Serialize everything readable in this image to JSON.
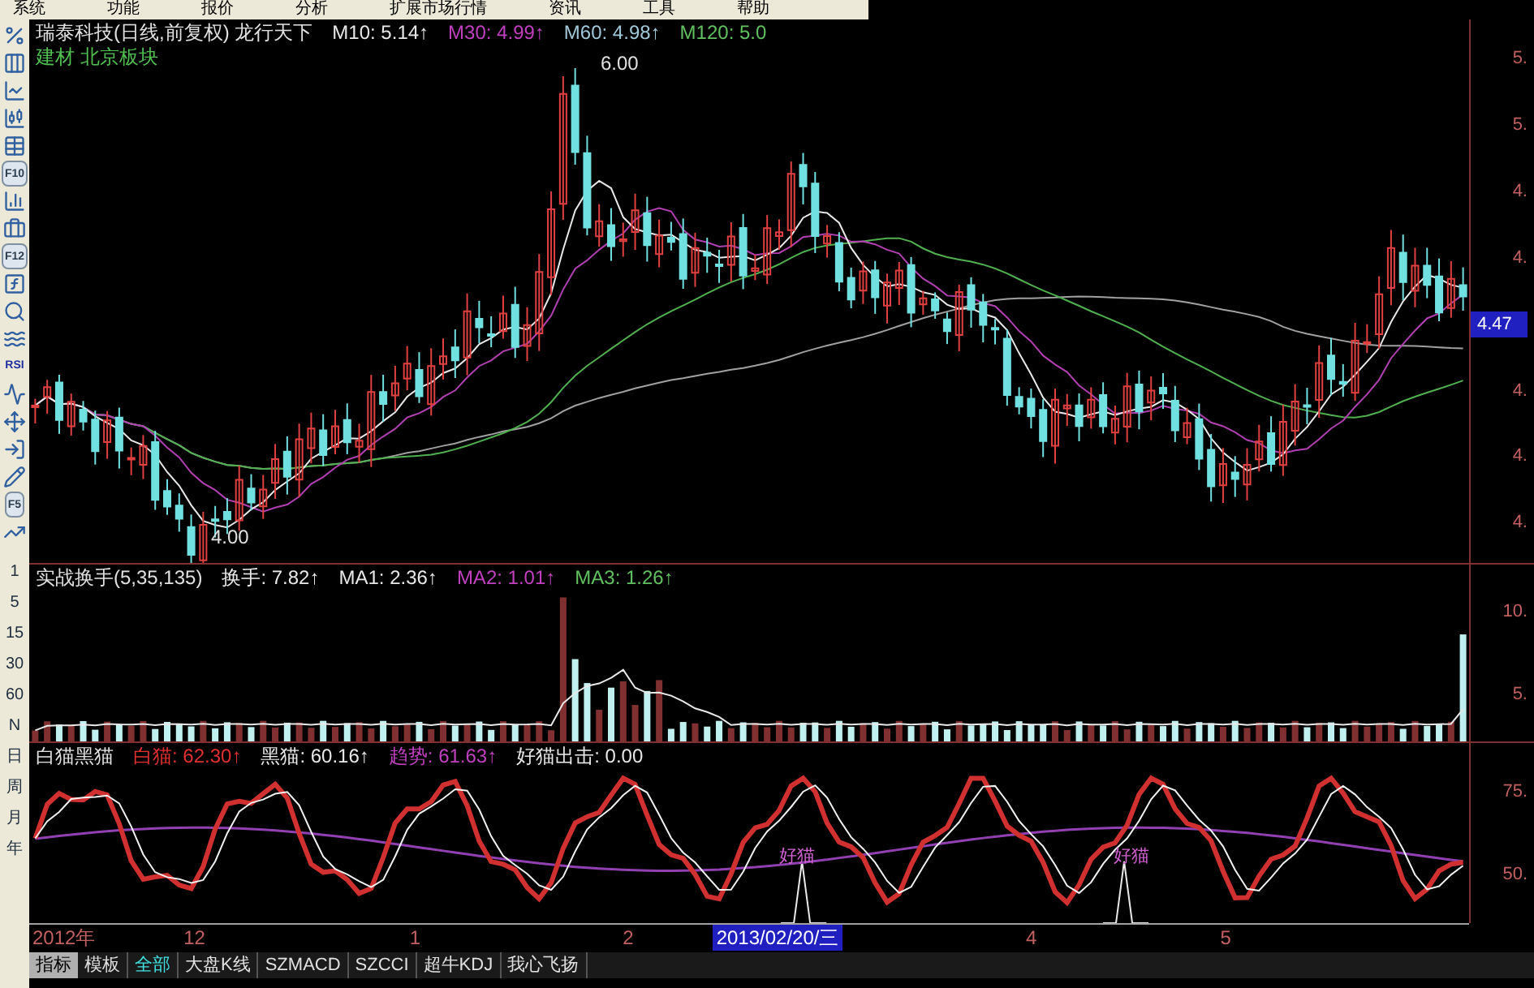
{
  "menu": [
    "系统",
    "功能",
    "报价",
    "分析",
    "扩展市场行情",
    "资讯",
    "工具",
    "帮助"
  ],
  "sidebar": {
    "items": [
      {
        "kind": "icon"
      },
      {
        "kind": "icon"
      },
      {
        "kind": "icon"
      },
      {
        "kind": "icon"
      },
      {
        "kind": "icon"
      },
      {
        "kind": "label",
        "text": "F10"
      },
      {
        "kind": "icon"
      },
      {
        "kind": "icon"
      },
      {
        "kind": "label",
        "text": "F12"
      },
      {
        "kind": "icon"
      },
      {
        "kind": "icon"
      },
      {
        "kind": "icon"
      },
      {
        "kind": "label",
        "text": "RSI"
      },
      {
        "kind": "icon"
      },
      {
        "kind": "icon"
      },
      {
        "kind": "icon"
      },
      {
        "kind": "icon"
      },
      {
        "kind": "label",
        "text": "F5"
      },
      {
        "kind": "icon"
      }
    ],
    "periods": [
      "1",
      "5",
      "15",
      "30",
      "60",
      "N",
      "日",
      "周",
      "月",
      "年"
    ]
  },
  "price_panel": {
    "title": "瑞泰科技(日线,前复权) 龙行天下",
    "indicators": [
      {
        "label": "M10: 5.14↑",
        "color": "#e8e8e8"
      },
      {
        "label": "M30: 4.99↑",
        "color": "#c040c0"
      },
      {
        "label": "M60: 4.98↑",
        "color": "#a0c8d8"
      },
      {
        "label": "M120: 5.0",
        "color": "#60c060"
      }
    ],
    "sector": "建材 北京板块",
    "annotations": [
      "6.00",
      "4.00"
    ],
    "axis": [
      {
        "kind": "tick",
        "text": "5."
      },
      {
        "kind": "tick",
        "text": "5."
      },
      {
        "kind": "tick",
        "text": "4."
      },
      {
        "kind": "tick",
        "text": "4."
      },
      {
        "kind": "current",
        "text": "4.47"
      },
      {
        "kind": "tick",
        "text": "4."
      },
      {
        "kind": "tick",
        "text": "4."
      },
      {
        "kind": "tick",
        "text": "4."
      }
    ]
  },
  "volume_panel": {
    "title": "实战换手(5,35,135)",
    "indicators": [
      {
        "label": "换手: 7.82↑",
        "color": "#e8e8e8"
      },
      {
        "label": "MA1: 2.36↑",
        "color": "#e8e8e8"
      },
      {
        "label": "MA2: 1.01↑",
        "color": "#c040c0"
      },
      {
        "label": "MA3: 1.26↑",
        "color": "#60c060"
      }
    ],
    "axis": [
      "10.",
      "5."
    ]
  },
  "cat_panel": {
    "title": "白猫黑猫",
    "indicators": [
      {
        "label": "白猫: 62.30↑",
        "color": "#e03030"
      },
      {
        "label": "黑猫: 60.16↑",
        "color": "#e8e8e8"
      },
      {
        "label": "趋势: 61.63↑",
        "color": "#c040c0"
      },
      {
        "label": "好猫出击: 0.00",
        "color": "#e8e8e8"
      }
    ],
    "annotations": [
      "好猫",
      "好猫"
    ],
    "axis": [
      "75.",
      "50."
    ]
  },
  "time_axis": [
    {
      "kind": "tick",
      "text": "2012年"
    },
    {
      "kind": "tick",
      "text": "12"
    },
    {
      "kind": "tick",
      "text": "1"
    },
    {
      "kind": "tick",
      "text": "2"
    },
    {
      "kind": "cursor",
      "text": "2013/02/20/三"
    },
    {
      "kind": "tick",
      "text": "4"
    },
    {
      "kind": "tick",
      "text": "5"
    }
  ],
  "tabs_label": "指标",
  "tabs": [
    {
      "text": "模板",
      "selected": false
    },
    {
      "text": "全部",
      "selected": true
    },
    {
      "text": "大盘K线",
      "selected": false
    },
    {
      "text": "SZMACD",
      "selected": false
    },
    {
      "text": "SZCCI",
      "selected": false
    },
    {
      "text": "超牛KDJ",
      "selected": false
    },
    {
      "text": "我心飞扬",
      "selected": false
    }
  ]
}
